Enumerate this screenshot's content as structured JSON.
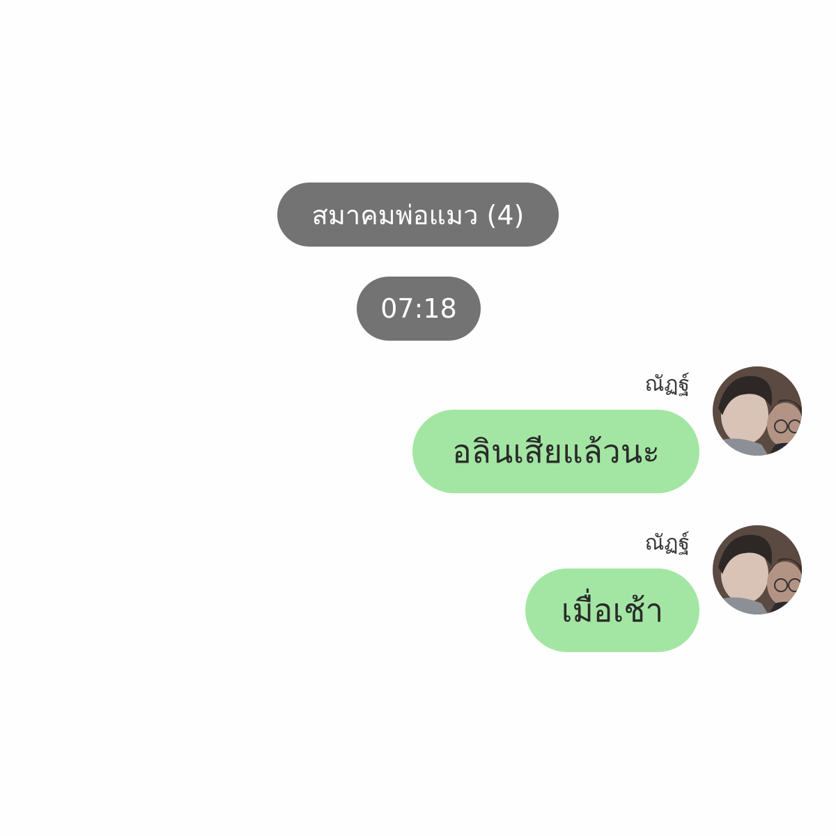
{
  "chat": {
    "group_title": "สมาคมพ่อแมว (4)",
    "timestamp": "07:18",
    "messages": [
      {
        "sender": "ณัฏฐ์",
        "text": "อลินเสียแล้วนะ",
        "avatar_icon": "user-avatar"
      },
      {
        "sender": "ณัฏฐ์",
        "text": "เมื่อเช้า",
        "avatar_icon": "user-avatar"
      }
    ]
  },
  "colors": {
    "background": "#fefefe",
    "system_pill": "#737373",
    "outgoing_bubble": "#a3e6a3"
  }
}
